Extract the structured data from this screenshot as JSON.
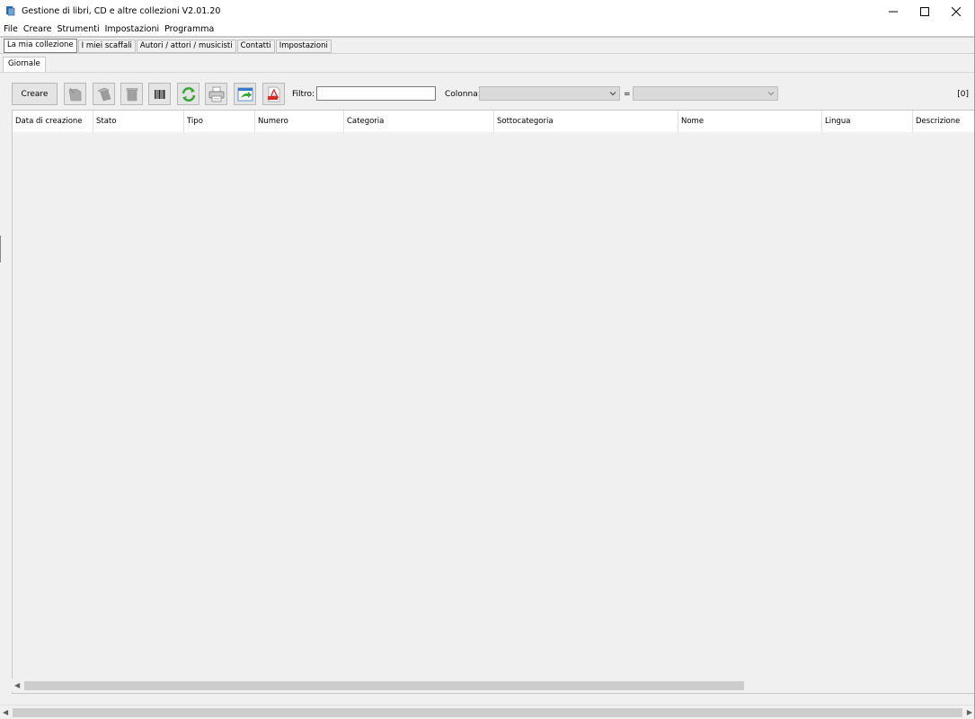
{
  "window": {
    "title": "Gestione di libri, CD e altre collezioni V2.01.20",
    "controls": [
      "minimize-icon",
      "maximize-icon",
      "close-icon"
    ]
  },
  "menu": {
    "items": [
      {
        "label": "File"
      },
      {
        "label": "Creare"
      },
      {
        "label": "Strumenti"
      },
      {
        "label": "Impostazioni"
      },
      {
        "label": "Programma"
      }
    ]
  },
  "tabs": {
    "items": [
      {
        "label": "La mia collezione",
        "active": true
      },
      {
        "label": "I miei scaffali"
      },
      {
        "label": "Autori / attori / musicisti"
      },
      {
        "label": "Contatti"
      },
      {
        "label": "Impostazioni"
      }
    ]
  },
  "subtabs": {
    "items": [
      {
        "label": "Giornale",
        "active": true
      }
    ]
  },
  "toolbar": {
    "create_label": "Creare",
    "icons": [
      "edit-icon",
      "copy-icon",
      "delete-icon",
      "barcode-icon",
      "refresh-icon",
      "print-icon",
      "export-icon",
      "pdf-icon"
    ],
    "filter_label": "Filtro:",
    "filter_value": "",
    "column_label": "Colonna:",
    "column_value": "",
    "equals_label": "=",
    "equals_value": "",
    "count": "[0]"
  },
  "table": {
    "columns": [
      {
        "label": "Data di creazione"
      },
      {
        "label": "Stato"
      },
      {
        "label": "Tipo"
      },
      {
        "label": "Numero"
      },
      {
        "label": "Categoria"
      },
      {
        "label": "Sottocategoria"
      },
      {
        "label": "Nome"
      },
      {
        "label": "Lingua"
      },
      {
        "label": "Descrizione"
      }
    ],
    "rows": []
  },
  "colors": {
    "background": "#f0f0f0",
    "button_bg": "#e4e4e4",
    "refresh_green": "#3aa63a",
    "pdf_red": "#d42a2a",
    "export_blue": "#3a7bc8",
    "app_icon_blue": "#2a6fb0"
  }
}
